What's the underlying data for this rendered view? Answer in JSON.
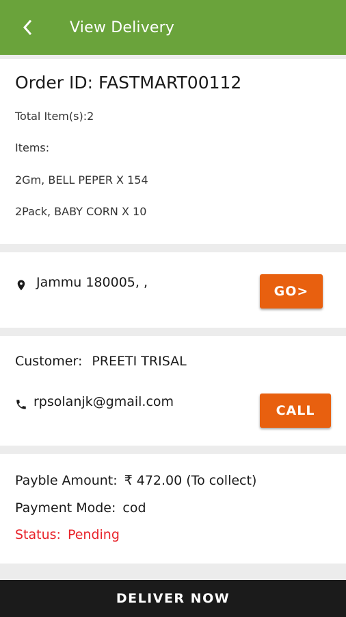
{
  "header": {
    "title": "View Delivery",
    "back_icon": "chevron-left-icon"
  },
  "order": {
    "id_label": "Order ID: FASTMART00112",
    "total_items": "Total Item(s):2",
    "items_label": "Items:",
    "items": [
      "2Gm, BELL PEPER X 154",
      "2Pack, BABY CORN X 10"
    ]
  },
  "location": {
    "address": "Jammu 180005, ,",
    "icon": "location-pin-icon",
    "go_label": "GO>"
  },
  "customer": {
    "label": "Customer:",
    "name": "PREETI TRISAL",
    "email": "rpsolanjk@gmail.com",
    "phone_icon": "phone-icon",
    "call_label": "CALL"
  },
  "payment": {
    "amount_label": "Payble Amount:",
    "amount_value": "₹ 472.00 (To collect)",
    "mode_label": "Payment Mode:",
    "mode_value": "cod",
    "status_label": "Status:",
    "status_value": "Pending"
  },
  "footer": {
    "button_label": "DELIVER NOW"
  },
  "colors": {
    "appbar": "#6aa33b",
    "button": "#e8600f",
    "status": "#e8232a",
    "footer": "#1b1b1b"
  }
}
